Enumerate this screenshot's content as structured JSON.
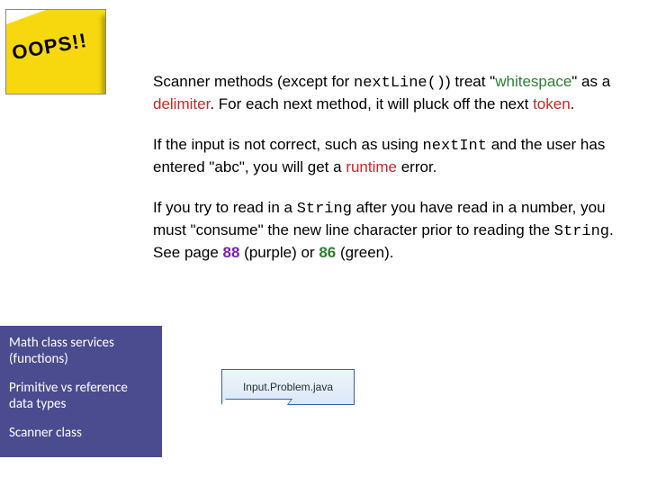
{
  "oops_image_text": "OOPS!!",
  "para1": {
    "a": "Scanner methods (except for ",
    "code": "nextLine()",
    "b": ") treat \"",
    "ws": "whitespace",
    "c": "\" as a ",
    "delim": "delimiter",
    "d": ".  For each next method, it will pluck off the next ",
    "token": "token",
    "e": "."
  },
  "para2": {
    "a": "If the input is not correct, such as using ",
    "code": "nextInt",
    "b": " and the user has entered \"abc\", you will get a ",
    "runtime": "runtime",
    "c": " error."
  },
  "para3": {
    "a": "If you try to read in a ",
    "code1": "String",
    "b": " after you have read in a number, you must \"consume\" the new line character prior to reading the ",
    "code2": "String",
    "c": ".  See page ",
    "p88": "88",
    "d": " (purple) or ",
    "p86": "86",
    "e": " (green)."
  },
  "sidebar": {
    "items": [
      "Math class services (functions)",
      "Primitive vs reference data types",
      "Scanner class"
    ]
  },
  "file_card_label": "Input.Problem.java"
}
